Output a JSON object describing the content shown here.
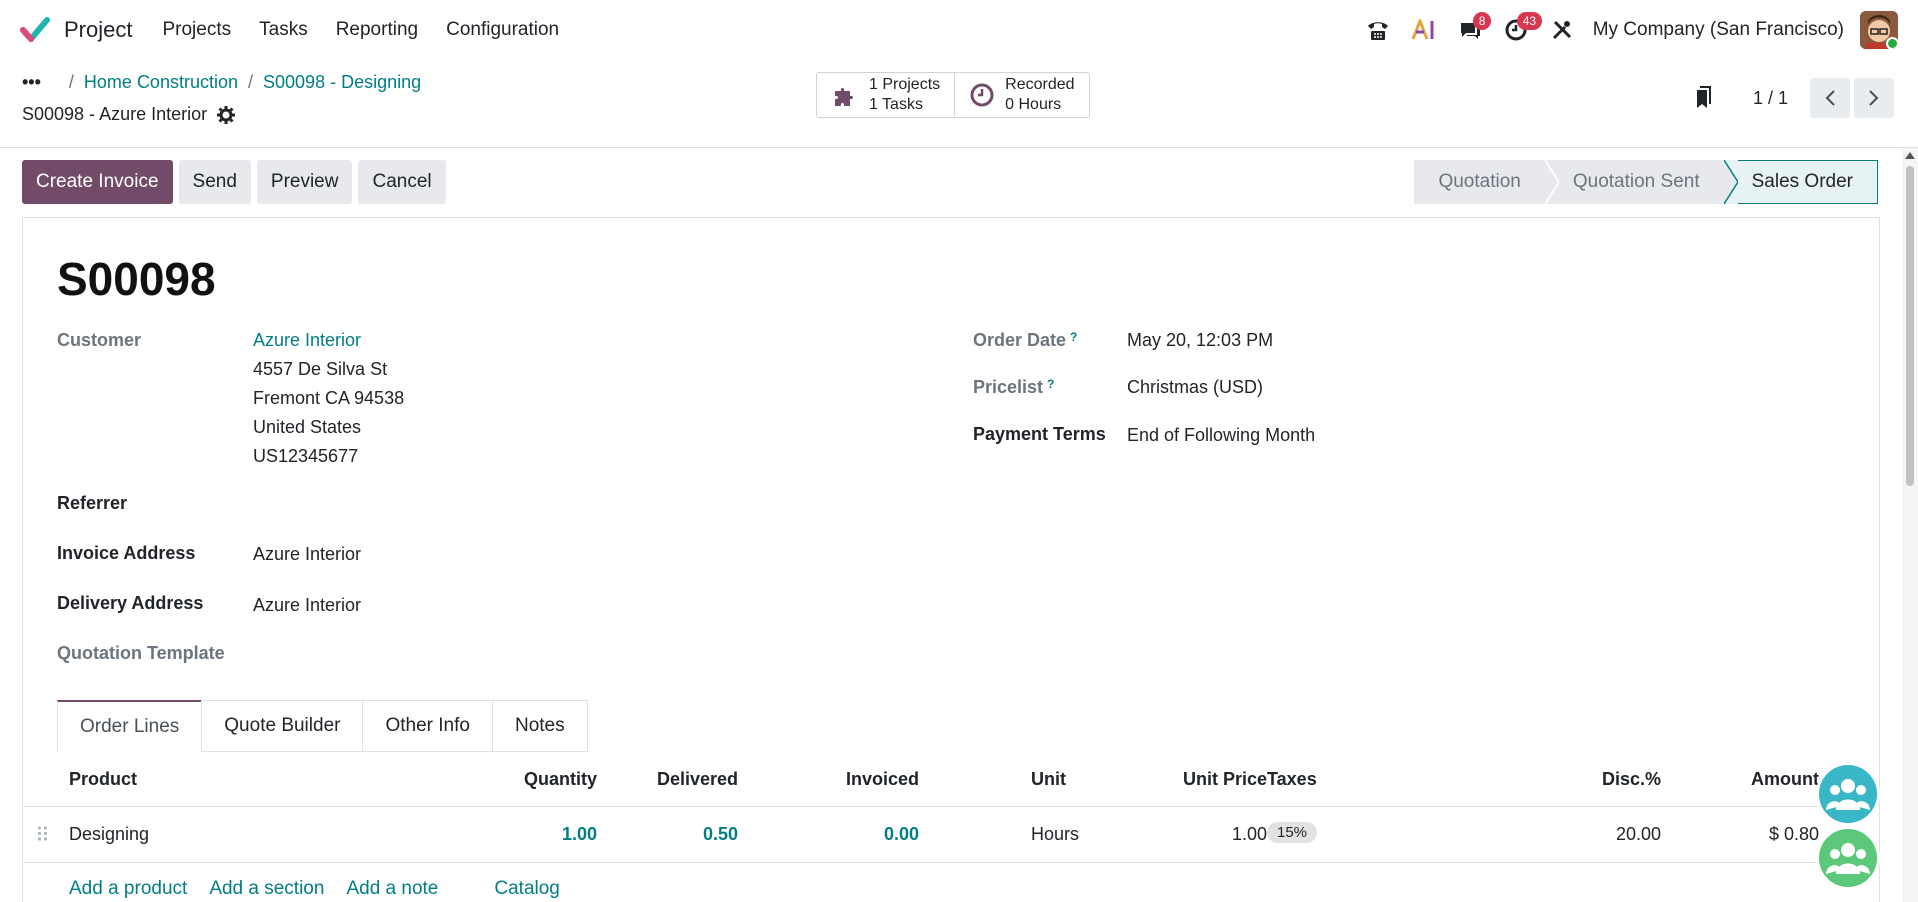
{
  "nav": {
    "app_name": "Project",
    "menu": [
      "Projects",
      "Tasks",
      "Reporting",
      "Configuration"
    ],
    "icons": [
      "phone-icon",
      "ai-icon",
      "chat-icon",
      "clock-icon",
      "tools-icon"
    ],
    "chat_badge": "8",
    "activity_badge": "43",
    "company": "My Company (San Francisco)",
    "colors": {
      "brand": "#714b67",
      "link": "#017e84",
      "badge": "#d9364f"
    }
  },
  "breadcrumb": {
    "dots": "•••",
    "items": [
      "Home Construction",
      "S00098 - Designing"
    ],
    "current": "S00098 - Azure Interior"
  },
  "smart_buttons": {
    "projects_line1": "1 Projects",
    "projects_line2": "1 Tasks",
    "recorded_line1": "Recorded",
    "recorded_line2": "0 Hours"
  },
  "pager": {
    "value": "1 / 1"
  },
  "actions": {
    "create_invoice": "Create Invoice",
    "send": "Send",
    "preview": "Preview",
    "cancel": "Cancel"
  },
  "status": [
    "Quotation",
    "Quotation Sent",
    "Sales Order"
  ],
  "record": {
    "name": "S00098",
    "customer_label": "Customer",
    "customer_name": "Azure Interior",
    "address_line1": "4557 De Silva St",
    "address_line2": "Fremont CA 94538",
    "address_line3": "United States",
    "address_line4": "US12345677",
    "referrer_label": "Referrer",
    "invoice_address_label": "Invoice Address",
    "invoice_address": "Azure Interior",
    "delivery_address_label": "Delivery Address",
    "delivery_address": "Azure Interior",
    "quotation_template_label": "Quotation Template",
    "order_date_label": "Order Date",
    "order_date": "May 20, 12:03 PM",
    "pricelist_label": "Pricelist",
    "pricelist": "Christmas (USD)",
    "payment_terms_label": "Payment Terms",
    "payment_terms": "End of Following Month",
    "help_mark": "?"
  },
  "tabs": [
    "Order Lines",
    "Quote Builder",
    "Other Info",
    "Notes"
  ],
  "table": {
    "headers": {
      "product": "Product",
      "quantity": "Quantity",
      "delivered": "Delivered",
      "invoiced": "Invoiced",
      "unit": "Unit",
      "unit_price": "Unit Price",
      "taxes": "Taxes",
      "disc": "Disc.%",
      "amount": "Amount"
    },
    "rows": [
      {
        "handle": "⠿",
        "product": "Designing",
        "quantity": "1.00",
        "delivered": "0.50",
        "invoiced": "0.00",
        "unit": "Hours",
        "unit_price": "1.00",
        "taxes": "15%",
        "disc": "20.00",
        "amount": "$ 0.80"
      }
    ],
    "add_links": [
      "Add a product",
      "Add a section",
      "Add a note",
      "Catalog"
    ]
  }
}
